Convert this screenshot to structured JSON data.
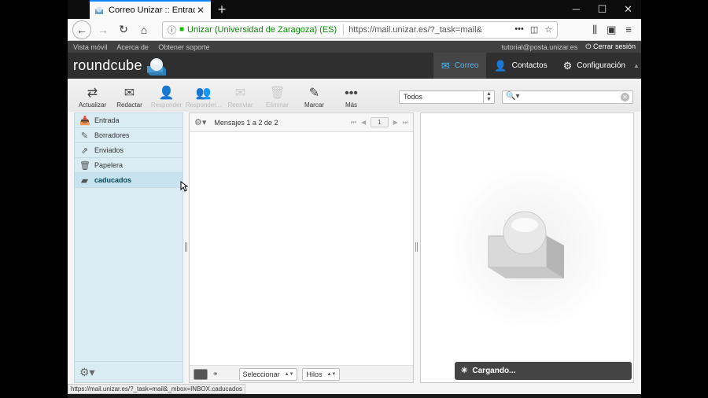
{
  "browser": {
    "tab_title": "Correo Unizar :: Entrada",
    "identity": "Unizar (Universidad de Zaragoza) (ES)",
    "url": "https://mail.unizar.es/?_task=mail&",
    "status_url": "https://mail.unizar.es/?_task=mail&_mbox=INBOX.caducados"
  },
  "topline": {
    "links": [
      "Vista móvil",
      "Acerca de",
      "Obtener soporte"
    ],
    "user": "tutorial@posta.unizar.es",
    "logout": "Cerrar sesión"
  },
  "header": {
    "logo": "roundcube",
    "tasks": [
      {
        "label": "Correo",
        "icon": "mail-icon"
      },
      {
        "label": "Contactos",
        "icon": "person-icon"
      },
      {
        "label": "Configuración",
        "icon": "gear-icon"
      }
    ]
  },
  "toolbar": {
    "buttons": [
      {
        "label": "Actualizar",
        "icon": "refresh-icon",
        "enabled": true
      },
      {
        "label": "Redactar",
        "icon": "compose-icon",
        "enabled": true
      },
      {
        "label": "Responder",
        "icon": "reply-icon",
        "enabled": false
      },
      {
        "label": "Responder...",
        "icon": "reply-all-icon",
        "enabled": false
      },
      {
        "label": "Reenviar",
        "icon": "forward-icon",
        "enabled": false
      },
      {
        "label": "Eliminar",
        "icon": "trash-icon",
        "enabled": false
      },
      {
        "label": "Marcar",
        "icon": "mark-icon",
        "enabled": true
      },
      {
        "label": "Más",
        "icon": "more-icon",
        "enabled": true
      }
    ],
    "filter_value": "Todos"
  },
  "folders": [
    {
      "label": "Entrada",
      "icon": "inbox-icon",
      "selected": false
    },
    {
      "label": "Borradores",
      "icon": "pencil-icon",
      "selected": false
    },
    {
      "label": "Enviados",
      "icon": "sent-icon",
      "selected": false
    },
    {
      "label": "Papelera",
      "icon": "trash-icon",
      "selected": false
    },
    {
      "label": "caducados",
      "icon": "folder-icon",
      "selected": true
    }
  ],
  "messagelist": {
    "count_text": "Mensajes 1 a 2 de 2",
    "page": "1",
    "select_label": "Seleccionar",
    "threads_label": "Hilos"
  },
  "preview": {
    "loading": "Cargando..."
  }
}
